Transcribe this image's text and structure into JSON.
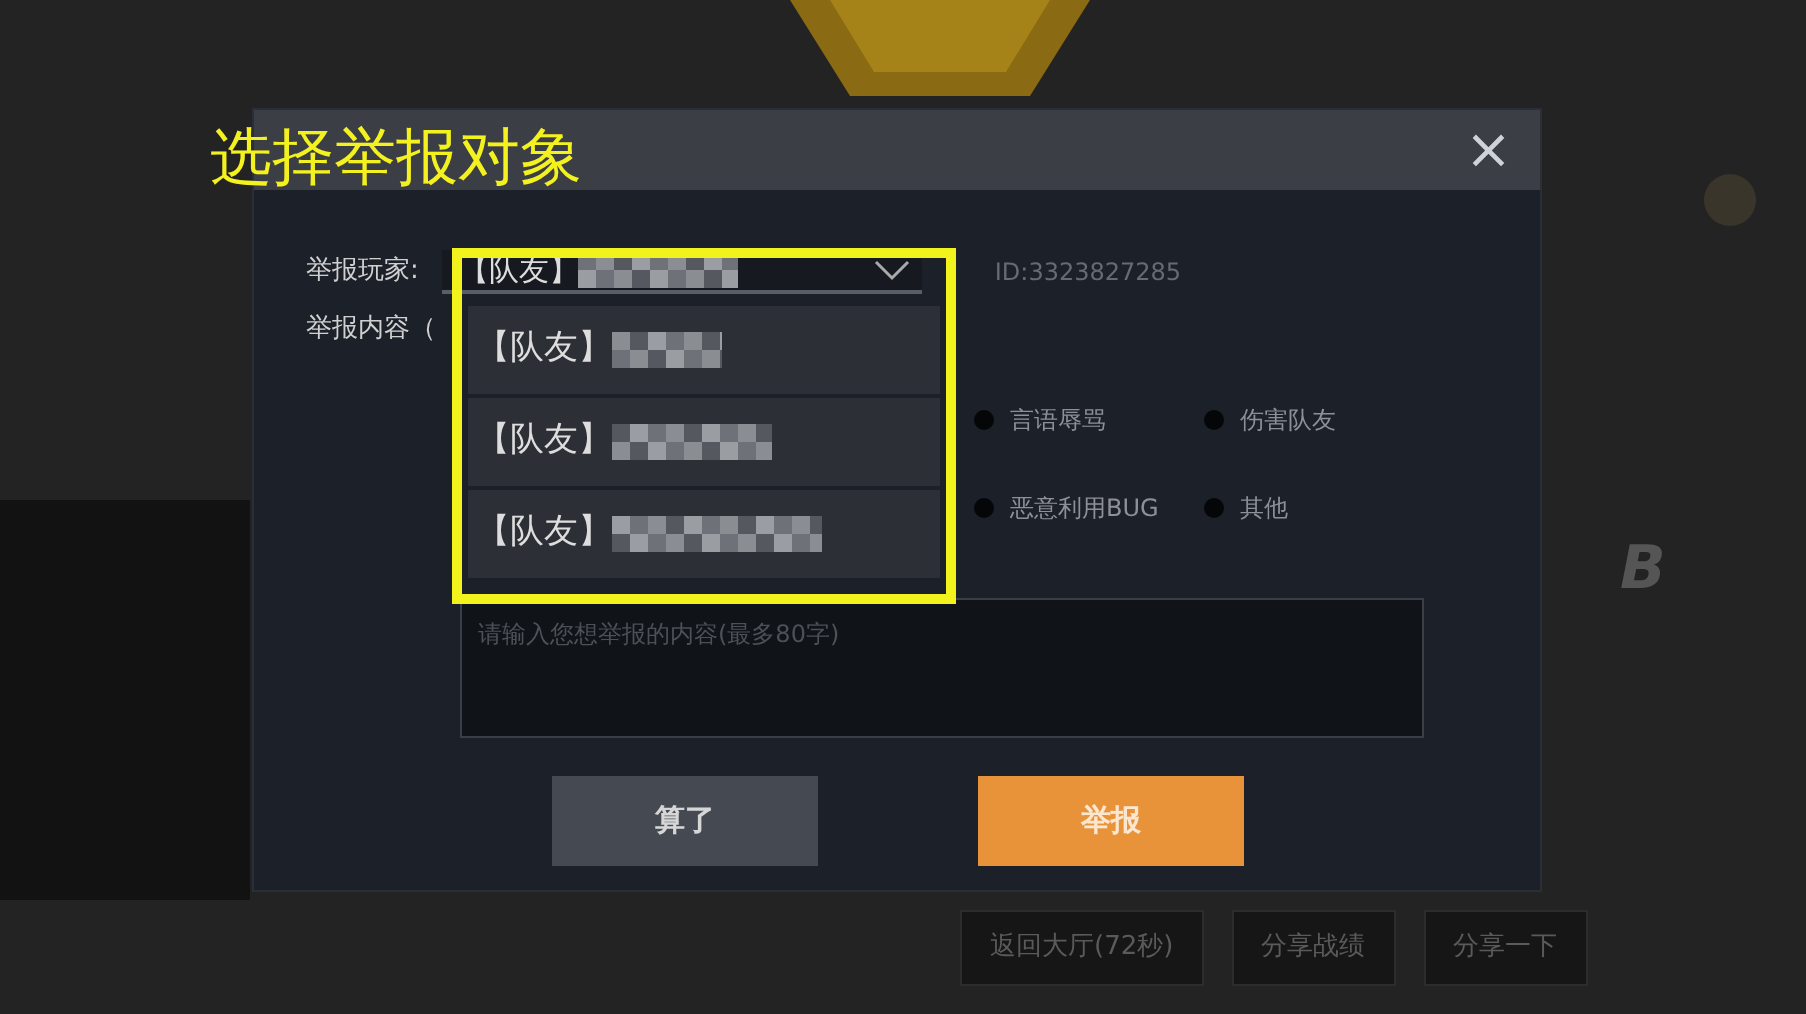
{
  "annotation": {
    "title": "选择举报对象"
  },
  "dialog": {
    "close": "×",
    "player_label": "举报玩家:",
    "selected_player": "【队友】",
    "player_id": "ID:3323827285",
    "content_label": "举报内容（",
    "options": [
      {
        "label": "言语辱骂",
        "selected": false
      },
      {
        "label": "伤害队友",
        "selected": false
      },
      {
        "label": "恶意利用BUG",
        "selected": false
      },
      {
        "label": "其他",
        "selected": false
      }
    ],
    "dropdown": [
      {
        "label": "【队友】"
      },
      {
        "label": "【队友】"
      },
      {
        "label": "【队友】"
      }
    ],
    "textarea": {
      "placeholder": "请输入您想举报的内容(最多80字)"
    },
    "buttons": [
      {
        "label": "算了",
        "kind": "secondary"
      },
      {
        "label": "举报",
        "kind": "primary"
      }
    ]
  },
  "background": {
    "actions": [
      "返回大厅(72秒)",
      "分享战绩",
      "分享一下"
    ],
    "rank": "B"
  }
}
